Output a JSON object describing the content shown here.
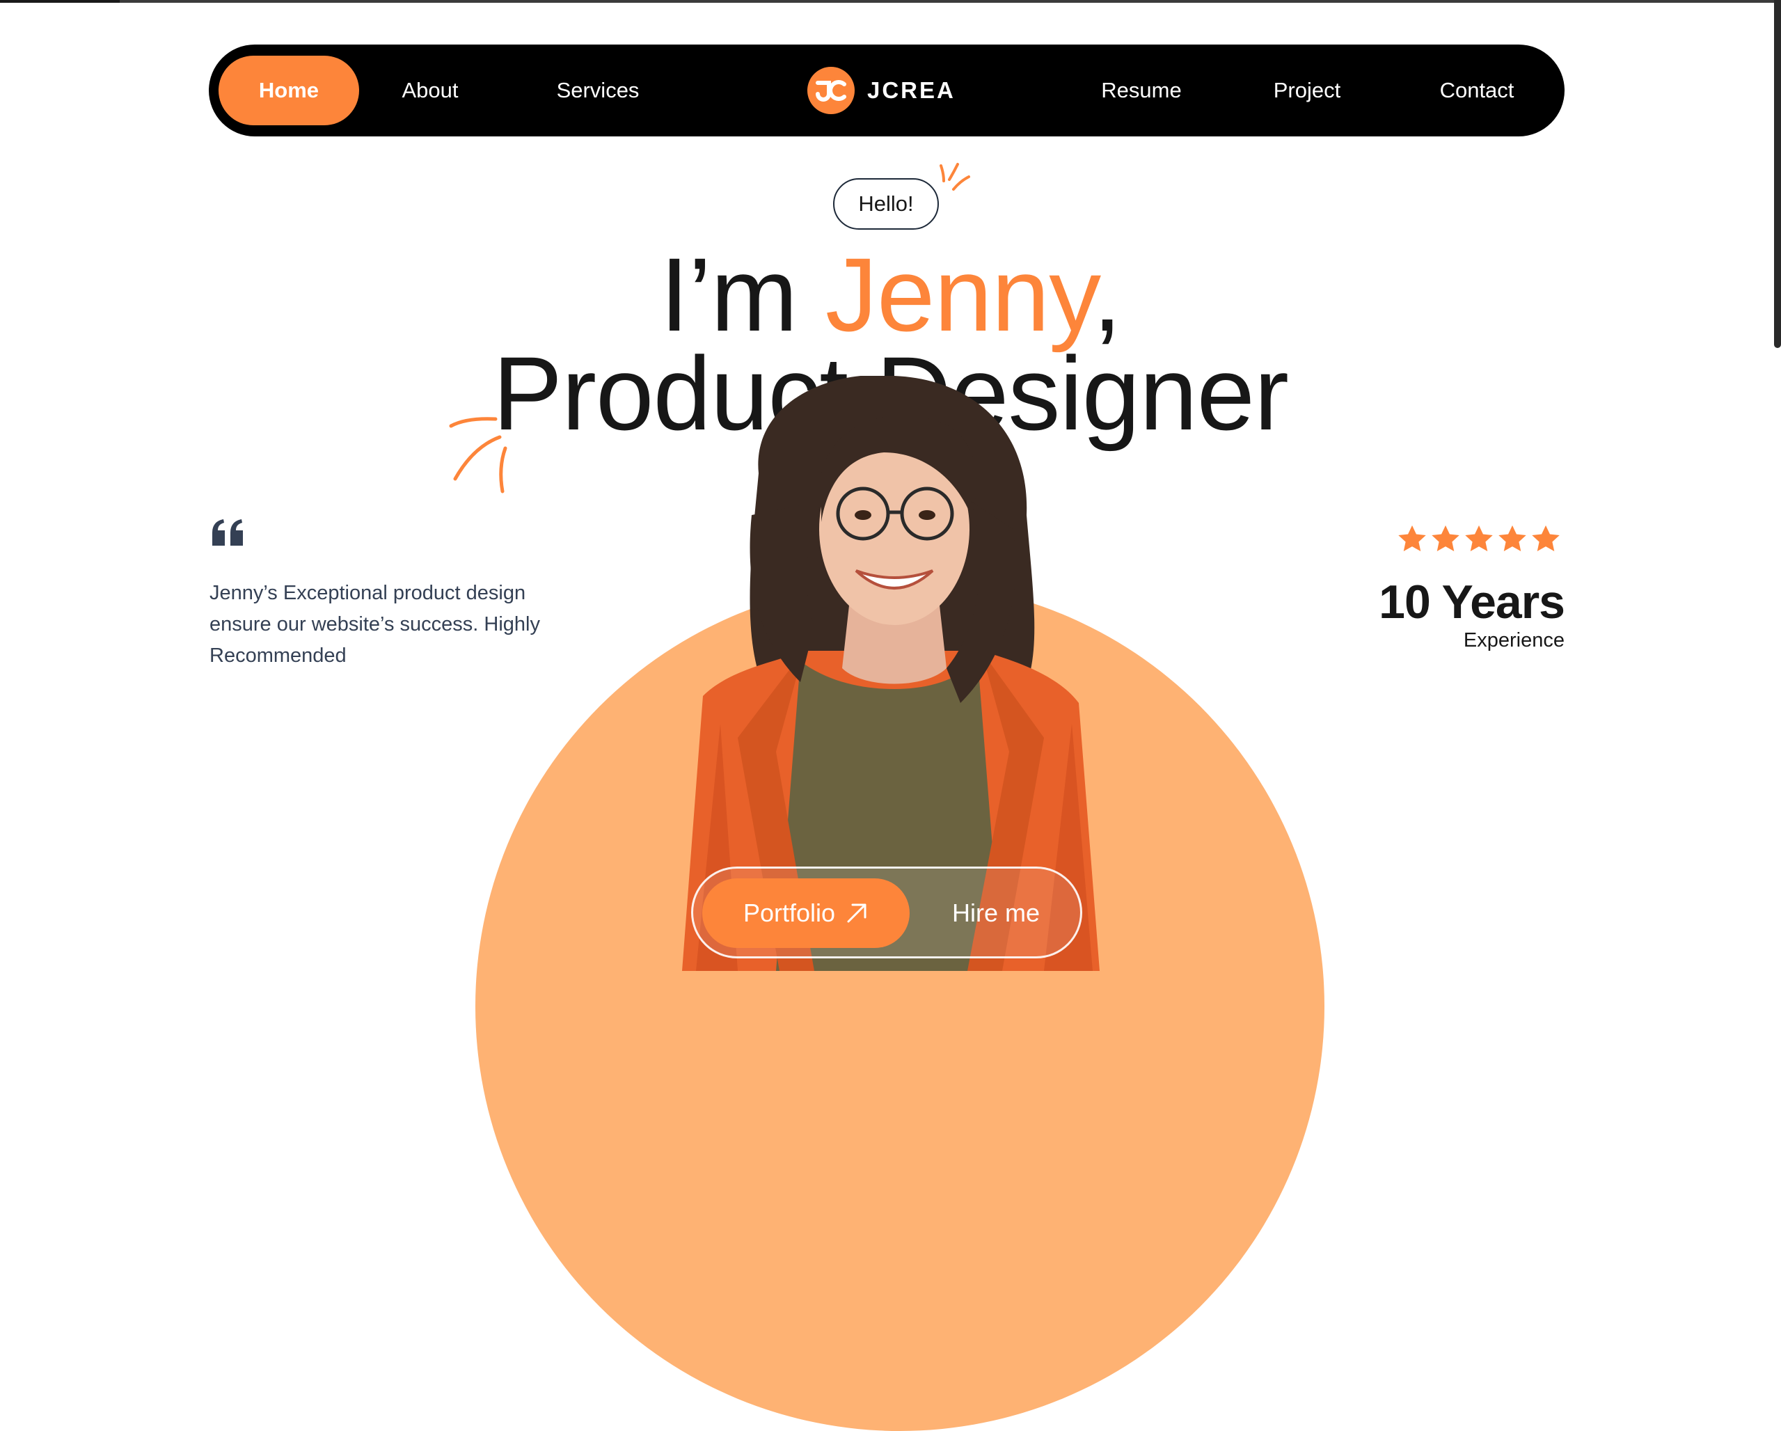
{
  "nav": {
    "items": [
      {
        "label": "Home",
        "active": true
      },
      {
        "label": "About"
      },
      {
        "label": "Services"
      },
      {
        "label": "Resume"
      },
      {
        "label": "Project"
      },
      {
        "label": "Contact"
      }
    ],
    "brand": "JCREA"
  },
  "hero": {
    "greeting": "Hello!",
    "intro_prefix": "I’m ",
    "name": "Jenny",
    "intro_suffix": ",",
    "role": "Product Designer"
  },
  "testimonial": {
    "text": "Jenny’s Exceptional product design ensure our website’s success. Highly Recommended"
  },
  "experience": {
    "rating": 5,
    "value": "10 Years",
    "label": "Experience"
  },
  "cta": {
    "primary": "Portfolio",
    "secondary": "Hire me"
  },
  "colors": {
    "accent": "#fd853a",
    "circle": "#feb273",
    "nav_bg": "#000000"
  }
}
